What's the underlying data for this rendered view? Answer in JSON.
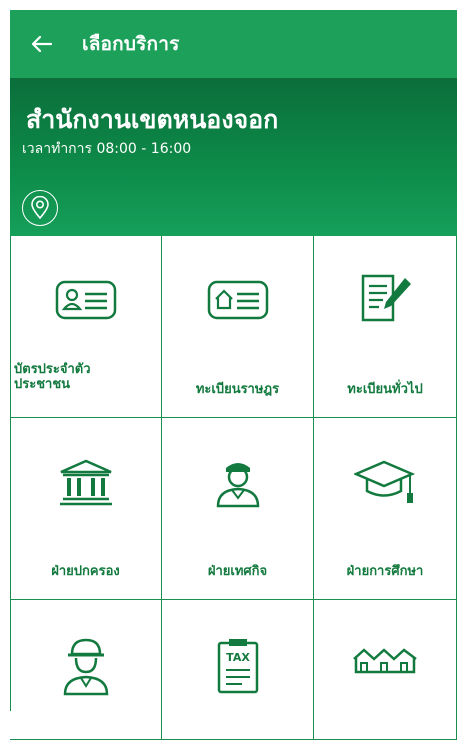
{
  "header": {
    "title": "เลือกบริการ"
  },
  "office": {
    "name": "สำนักงานเขตหนองจอก",
    "hours": "เวลาทำการ 08:00 - 16:00"
  },
  "services": [
    {
      "label": "บัตรประจำตัว\nประชาชน",
      "icon": "id-card-icon"
    },
    {
      "label": "ทะเบียนราษฎร",
      "icon": "house-card-icon"
    },
    {
      "label": "ทะเบียนทั่วไป",
      "icon": "document-pen-icon"
    },
    {
      "label": "ฝ่ายปกครอง",
      "icon": "government-building-icon"
    },
    {
      "label": "ฝ่ายเทศกิจ",
      "icon": "officer-icon"
    },
    {
      "label": "ฝ่ายการศึกษา",
      "icon": "graduation-cap-icon"
    },
    {
      "label": "",
      "icon": "engineer-icon"
    },
    {
      "label": "",
      "icon": "tax-clipboard-icon",
      "icon_text": "TAX"
    },
    {
      "label": "",
      "icon": "houses-icon"
    }
  ],
  "colors": {
    "primary": "#1ca05a",
    "header_dark": "#0b6e3b",
    "text": "#137a3f",
    "grid": "#1a8e4f"
  }
}
